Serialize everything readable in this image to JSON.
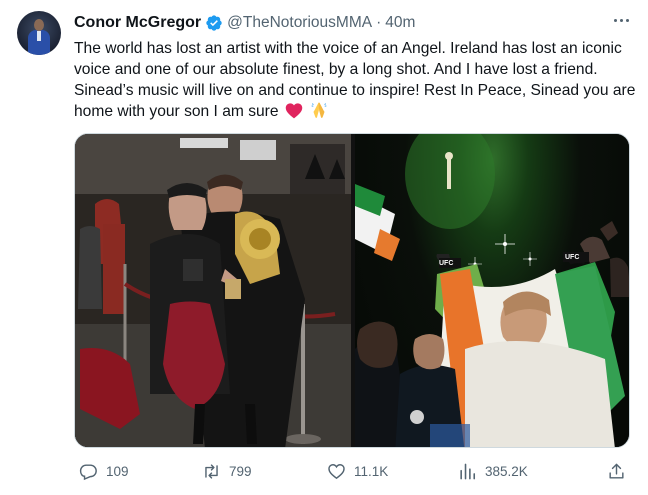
{
  "tweet": {
    "author_name": "Conor McGregor",
    "handle": "@TheNotoriousMMA",
    "separator": "·",
    "time": "40m",
    "verified": true,
    "text": "The world has lost an artist with the voice of an Angel. Ireland has lost an iconic voice and one of our absolute finest, by a long shot. And I have lost a friend. Sinead’s music will live on and continue to inspire! Rest In Peace, Sinead you are home with your son I am sure",
    "emojis": [
      "red-heart-icon",
      "folded-hands-icon"
    ]
  },
  "media": {
    "photos": [
      {
        "name": "photo-left"
      },
      {
        "name": "photo-right",
        "visible_text": [
          "UFC",
          "UFC"
        ]
      }
    ]
  },
  "actions": {
    "reply_count": "109",
    "retweet_count": "799",
    "like_count": "11.1K",
    "view_count": "385.2K"
  },
  "colors": {
    "verified_blue": "#1d9bf0",
    "text_primary": "#0f1419",
    "text_secondary": "#536471",
    "heart_red": "#e0245e"
  }
}
